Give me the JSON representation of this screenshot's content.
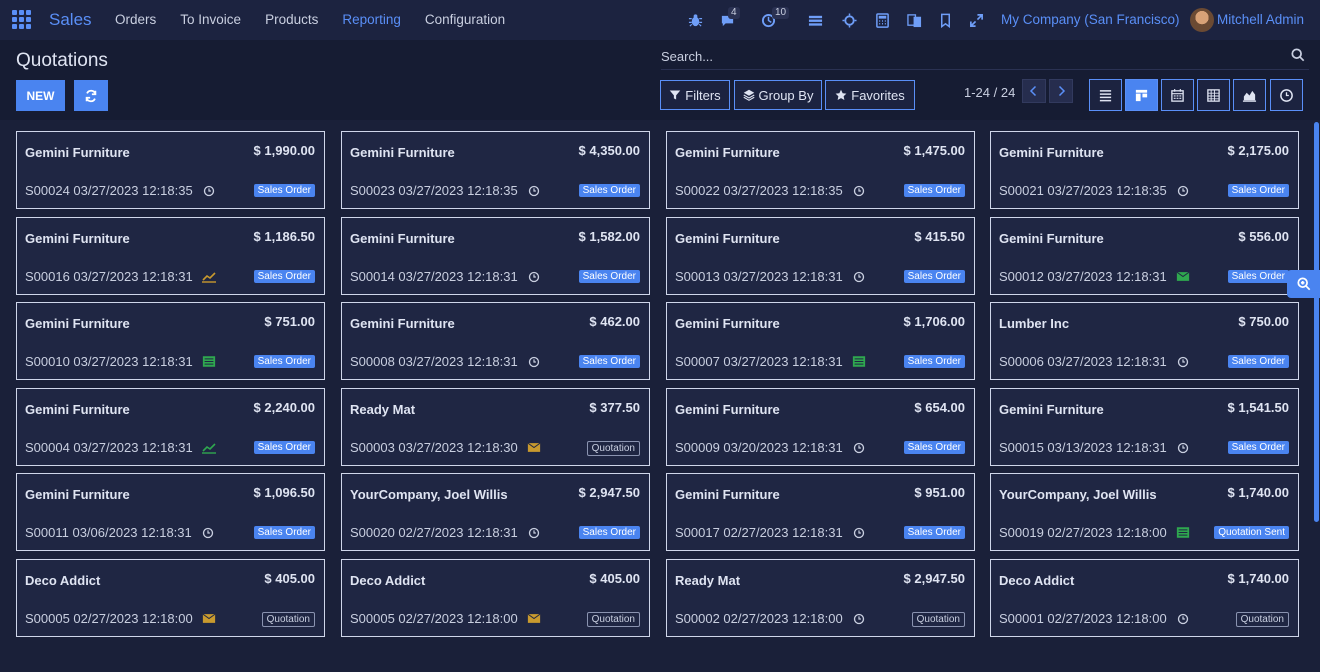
{
  "nav": {
    "brand": "Sales",
    "menu": [
      "Orders",
      "To Invoice",
      "Products",
      "Reporting",
      "Configuration"
    ],
    "active_menu": "Reporting",
    "messages_count": "4",
    "activities_count": "10",
    "company": "My Company (San Francisco)",
    "user": "Mitchell Admin"
  },
  "control": {
    "title": "Quotations",
    "new_label": "NEW",
    "search_placeholder": "Search...",
    "filters_label": "Filters",
    "groupby_label": "Group By",
    "favorites_label": "Favorites",
    "pager": "1-24 / 24",
    "views": [
      "list",
      "kanban",
      "calendar",
      "pivot",
      "graph",
      "activity"
    ],
    "active_view": "kanban"
  },
  "colors": {
    "accent": "#4a84f0",
    "activity_warning": "#c99a2e",
    "activity_success": "#2fa84f"
  },
  "cards": [
    {
      "customer": "Gemini Furniture",
      "amount": "$ 1,990.00",
      "ref": "S00024 03/27/2023 12:18:35",
      "activity": "clock",
      "state": "Sales Order",
      "state_type": "order"
    },
    {
      "customer": "Gemini Furniture",
      "amount": "$ 4,350.00",
      "ref": "S00023 03/27/2023 12:18:35",
      "activity": "clock",
      "state": "Sales Order",
      "state_type": "order"
    },
    {
      "customer": "Gemini Furniture",
      "amount": "$ 1,475.00",
      "ref": "S00022 03/27/2023 12:18:35",
      "activity": "clock",
      "state": "Sales Order",
      "state_type": "order"
    },
    {
      "customer": "Gemini Furniture",
      "amount": "$ 2,175.00",
      "ref": "S00021 03/27/2023 12:18:35",
      "activity": "clock",
      "state": "Sales Order",
      "state_type": "order"
    },
    {
      "customer": "Gemini Furniture",
      "amount": "$ 1,186.50",
      "ref": "S00016 03/27/2023 12:18:31",
      "activity": "chart",
      "state": "Sales Order",
      "state_type": "order"
    },
    {
      "customer": "Gemini Furniture",
      "amount": "$ 1,582.00",
      "ref": "S00014 03/27/2023 12:18:31",
      "activity": "clock",
      "state": "Sales Order",
      "state_type": "order"
    },
    {
      "customer": "Gemini Furniture",
      "amount": "$ 415.50",
      "ref": "S00013 03/27/2023 12:18:31",
      "activity": "clock",
      "state": "Sales Order",
      "state_type": "order"
    },
    {
      "customer": "Gemini Furniture",
      "amount": "$ 556.00",
      "ref": "S00012 03/27/2023 12:18:31",
      "activity": "mail-green",
      "state": "Sales Order",
      "state_type": "order"
    },
    {
      "customer": "Gemini Furniture",
      "amount": "$ 751.00",
      "ref": "S00010 03/27/2023 12:18:31",
      "activity": "list",
      "state": "Sales Order",
      "state_type": "order"
    },
    {
      "customer": "Gemini Furniture",
      "amount": "$ 462.00",
      "ref": "S00008 03/27/2023 12:18:31",
      "activity": "clock",
      "state": "Sales Order",
      "state_type": "order"
    },
    {
      "customer": "Gemini Furniture",
      "amount": "$ 1,706.00",
      "ref": "S00007 03/27/2023 12:18:31",
      "activity": "list",
      "state": "Sales Order",
      "state_type": "order"
    },
    {
      "customer": "Lumber Inc",
      "amount": "$ 750.00",
      "ref": "S00006 03/27/2023 12:18:31",
      "activity": "clock",
      "state": "Sales Order",
      "state_type": "order"
    },
    {
      "customer": "Gemini Furniture",
      "amount": "$ 2,240.00",
      "ref": "S00004 03/27/2023 12:18:31",
      "activity": "chart-green",
      "state": "Sales Order",
      "state_type": "order"
    },
    {
      "customer": "Ready Mat",
      "amount": "$ 377.50",
      "ref": "S00003 03/27/2023 12:18:30",
      "activity": "mail",
      "state": "Quotation",
      "state_type": "quote"
    },
    {
      "customer": "Gemini Furniture",
      "amount": "$ 654.00",
      "ref": "S00009 03/20/2023 12:18:31",
      "activity": "clock",
      "state": "Sales Order",
      "state_type": "order"
    },
    {
      "customer": "Gemini Furniture",
      "amount": "$ 1,541.50",
      "ref": "S00015 03/13/2023 12:18:31",
      "activity": "clock",
      "state": "Sales Order",
      "state_type": "order"
    },
    {
      "customer": "Gemini Furniture",
      "amount": "$ 1,096.50",
      "ref": "S00011 03/06/2023 12:18:31",
      "activity": "clock",
      "state": "Sales Order",
      "state_type": "order"
    },
    {
      "customer": "YourCompany, Joel Willis",
      "amount": "$ 2,947.50",
      "ref": "S00020 02/27/2023 12:18:31",
      "activity": "clock",
      "state": "Sales Order",
      "state_type": "order"
    },
    {
      "customer": "Gemini Furniture",
      "amount": "$ 951.00",
      "ref": "S00017 02/27/2023 12:18:31",
      "activity": "clock",
      "state": "Sales Order",
      "state_type": "order"
    },
    {
      "customer": "YourCompany, Joel Willis",
      "amount": "$ 1,740.00",
      "ref": "S00019 02/27/2023 12:18:00",
      "activity": "list",
      "state": "Quotation Sent",
      "state_type": "sent"
    },
    {
      "customer": "Deco Addict",
      "amount": "$ 405.00",
      "ref": "S00005 02/27/2023 12:18:00",
      "activity": "mail",
      "state": "Quotation",
      "state_type": "quote"
    },
    {
      "customer": "Deco Addict",
      "amount": "$ 405.00",
      "ref": "S00005 02/27/2023 12:18:00",
      "activity": "mail",
      "state": "Quotation",
      "state_type": "quote"
    },
    {
      "customer": "Ready Mat",
      "amount": "$ 2,947.50",
      "ref": "S00002 02/27/2023 12:18:00",
      "activity": "clock",
      "state": "Quotation",
      "state_type": "quote"
    },
    {
      "customer": "Deco Addict",
      "amount": "$ 1,740.00",
      "ref": "S00001 02/27/2023 12:18:00",
      "activity": "clock",
      "state": "Quotation",
      "state_type": "quote"
    }
  ]
}
